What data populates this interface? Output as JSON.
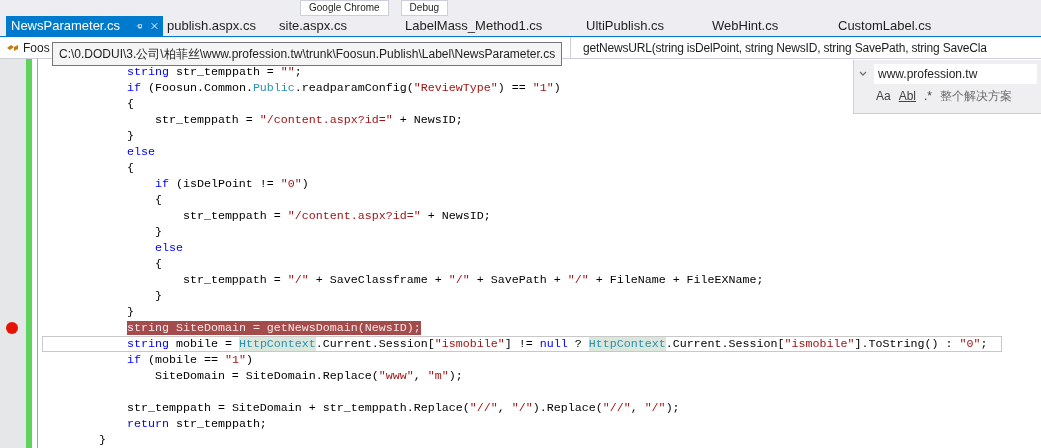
{
  "toolbar": {
    "items": [
      "Google Chrome",
      "Debug"
    ]
  },
  "tabs": [
    {
      "label": "NewsParameter.cs",
      "selected": true
    },
    {
      "label": "publish.aspx.cs",
      "selected": false
    },
    {
      "label": "site.aspx.cs",
      "selected": false
    },
    {
      "label": "LabelMass_Method1.cs",
      "selected": false
    },
    {
      "label": "UltiPublish.cs",
      "selected": false
    },
    {
      "label": "WebHint.cs",
      "selected": false
    },
    {
      "label": "CustomLabel.cs",
      "selected": false
    }
  ],
  "nav_bar": {
    "type_dropdown": "Foos",
    "member_dropdown": "getNewsURL(string isDelPoint, string NewsID, string SavePath, string SaveCla"
  },
  "tooltip": "C:\\0.DODUI\\3.公司\\柏菲丝\\www.profession.tw\\trunk\\Foosun.Publish\\Label\\NewsParameter.cs",
  "find_widget": {
    "value": "www.profession.tw",
    "options": [
      "Aa",
      "Abl",
      ".*"
    ],
    "scope": "整个解决方案"
  },
  "code_lines": [
    {
      "breakpoint": false,
      "current": false,
      "tokens": [
        {
          "text": "            string",
          "kind": "keyword"
        },
        {
          "text": " str_temppath = ",
          "kind": "plain"
        },
        {
          "text": "\"\"",
          "kind": "string"
        },
        {
          "text": ";",
          "kind": "plain"
        }
      ]
    },
    {
      "breakpoint": false,
      "current": false,
      "tokens": [
        {
          "text": "            if",
          "kind": "keyword"
        },
        {
          "text": " (Foosun.Common.",
          "kind": "plain"
        },
        {
          "text": "Public",
          "kind": "type"
        },
        {
          "text": ".readparamConfig(",
          "kind": "plain"
        },
        {
          "text": "\"ReviewType\"",
          "kind": "string"
        },
        {
          "text": ") == ",
          "kind": "plain"
        },
        {
          "text": "\"1\"",
          "kind": "string"
        },
        {
          "text": ")",
          "kind": "plain"
        }
      ]
    },
    {
      "breakpoint": false,
      "current": false,
      "tokens": [
        {
          "text": "            {",
          "kind": "plain"
        }
      ]
    },
    {
      "breakpoint": false,
      "current": false,
      "tokens": [
        {
          "text": "                str_temppath = ",
          "kind": "plain"
        },
        {
          "text": "\"/content.aspx?id=\"",
          "kind": "string"
        },
        {
          "text": " + NewsID;",
          "kind": "plain"
        }
      ]
    },
    {
      "breakpoint": false,
      "current": false,
      "tokens": [
        {
          "text": "            }",
          "kind": "plain"
        }
      ]
    },
    {
      "breakpoint": false,
      "current": false,
      "tokens": [
        {
          "text": "            else",
          "kind": "keyword"
        }
      ]
    },
    {
      "breakpoint": false,
      "current": false,
      "tokens": [
        {
          "text": "            {",
          "kind": "plain"
        }
      ]
    },
    {
      "breakpoint": false,
      "current": false,
      "tokens": [
        {
          "text": "                if",
          "kind": "keyword"
        },
        {
          "text": " (isDelPoint != ",
          "kind": "plain"
        },
        {
          "text": "\"0\"",
          "kind": "string"
        },
        {
          "text": ")",
          "kind": "plain"
        }
      ]
    },
    {
      "breakpoint": false,
      "current": false,
      "tokens": [
        {
          "text": "                {",
          "kind": "plain"
        }
      ]
    },
    {
      "breakpoint": false,
      "current": false,
      "tokens": [
        {
          "text": "                    str_temppath = ",
          "kind": "plain"
        },
        {
          "text": "\"/content.aspx?id=\"",
          "kind": "string"
        },
        {
          "text": " + NewsID;",
          "kind": "plain"
        }
      ]
    },
    {
      "breakpoint": false,
      "current": false,
      "tokens": [
        {
          "text": "                }",
          "kind": "plain"
        }
      ]
    },
    {
      "breakpoint": false,
      "current": false,
      "tokens": [
        {
          "text": "                else",
          "kind": "keyword"
        }
      ]
    },
    {
      "breakpoint": false,
      "current": false,
      "tokens": [
        {
          "text": "                {",
          "kind": "plain"
        }
      ]
    },
    {
      "breakpoint": false,
      "current": false,
      "tokens": [
        {
          "text": "                    str_temppath = ",
          "kind": "plain"
        },
        {
          "text": "\"/\"",
          "kind": "string"
        },
        {
          "text": " + SaveClassframe + ",
          "kind": "plain"
        },
        {
          "text": "\"/\"",
          "kind": "string"
        },
        {
          "text": " + SavePath + ",
          "kind": "plain"
        },
        {
          "text": "\"/\"",
          "kind": "string"
        },
        {
          "text": " + FileName + FileEXName;",
          "kind": "plain"
        }
      ]
    },
    {
      "breakpoint": false,
      "current": false,
      "tokens": [
        {
          "text": "                }",
          "kind": "plain"
        }
      ]
    },
    {
      "breakpoint": false,
      "current": false,
      "tokens": [
        {
          "text": "            }",
          "kind": "plain"
        }
      ]
    },
    {
      "breakpoint": true,
      "current": false,
      "tokens": [
        {
          "text": "            string",
          "kind": "keyword"
        },
        {
          "text": " SiteDomain = getNewsDomain(NewsID);",
          "kind": "plain"
        }
      ]
    },
    {
      "breakpoint": false,
      "current": true,
      "tokens": [
        {
          "text": "            string",
          "kind": "keyword"
        },
        {
          "text": " mobile = ",
          "kind": "plain"
        },
        {
          "text": "HttpContext",
          "kind": "type_ref"
        },
        {
          "text": ".Current.Session[",
          "kind": "plain"
        },
        {
          "text": "\"ismobile\"",
          "kind": "string"
        },
        {
          "text": "] != ",
          "kind": "plain"
        },
        {
          "text": "null",
          "kind": "keyword"
        },
        {
          "text": " ? ",
          "kind": "plain"
        },
        {
          "text": "HttpContext",
          "kind": "type_ref"
        },
        {
          "text": ".Current.Session[",
          "kind": "plain"
        },
        {
          "text": "\"ismobile\"",
          "kind": "string"
        },
        {
          "text": "].ToString() : ",
          "kind": "plain"
        },
        {
          "text": "\"0\"",
          "kind": "string"
        },
        {
          "text": ";",
          "kind": "plain"
        }
      ]
    },
    {
      "breakpoint": false,
      "current": false,
      "tokens": [
        {
          "text": "            if",
          "kind": "keyword"
        },
        {
          "text": " (mobile == ",
          "kind": "plain"
        },
        {
          "text": "\"1\"",
          "kind": "string"
        },
        {
          "text": ")",
          "kind": "plain"
        }
      ]
    },
    {
      "breakpoint": false,
      "current": false,
      "tokens": [
        {
          "text": "                SiteDomain = SiteDomain.Replace(",
          "kind": "plain"
        },
        {
          "text": "\"www\"",
          "kind": "string"
        },
        {
          "text": ", ",
          "kind": "plain"
        },
        {
          "text": "\"m\"",
          "kind": "string"
        },
        {
          "text": ");",
          "kind": "plain"
        }
      ]
    },
    {
      "breakpoint": false,
      "current": false
    },
    {
      "breakpoint": false,
      "current": false,
      "tokens": [
        {
          "text": "            str_temppath = SiteDomain + str_temppath.Replace(",
          "kind": "plain"
        },
        {
          "text": "\"//\"",
          "kind": "string"
        },
        {
          "text": ", ",
          "kind": "plain"
        },
        {
          "text": "\"/\"",
          "kind": "string"
        },
        {
          "text": ").Replace(",
          "kind": "plain"
        },
        {
          "text": "\"//\"",
          "kind": "string"
        },
        {
          "text": ", ",
          "kind": "plain"
        },
        {
          "text": "\"/\"",
          "kind": "string"
        },
        {
          "text": ");",
          "kind": "plain"
        }
      ]
    },
    {
      "breakpoint": false,
      "current": false,
      "tokens": [
        {
          "text": "            return",
          "kind": "keyword"
        },
        {
          "text": " str_temppath;",
          "kind": "plain"
        }
      ]
    },
    {
      "breakpoint": false,
      "current": false,
      "tokens": [
        {
          "text": "        }",
          "kind": "plain"
        }
      ]
    }
  ]
}
